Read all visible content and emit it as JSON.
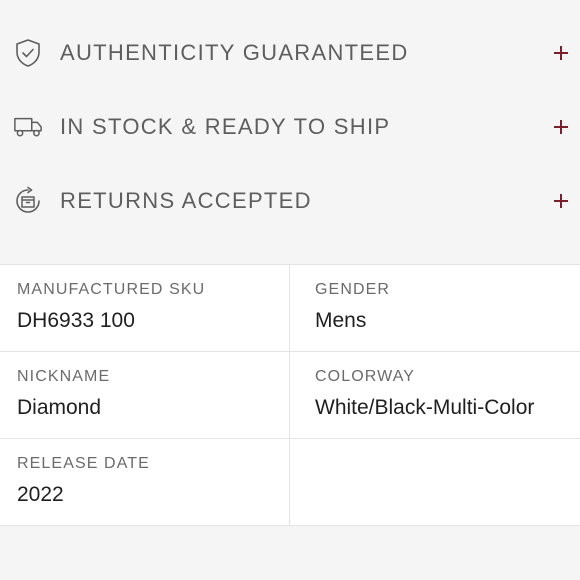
{
  "accordion": {
    "items": [
      {
        "label": "AUTHENTICITY GUARANTEED",
        "icon": "shield-check-icon"
      },
      {
        "label": "IN STOCK & READY TO SHIP",
        "icon": "truck-icon"
      },
      {
        "label": "RETURNS ACCEPTED",
        "icon": "return-box-icon"
      }
    ],
    "plus_color": "#7a1f2b"
  },
  "details": {
    "manufactured_sku": {
      "label": "MANUFACTURED SKU",
      "value": "DH6933 100"
    },
    "gender": {
      "label": "GENDER",
      "value": "Mens"
    },
    "nickname": {
      "label": "NICKNAME",
      "value": "Diamond"
    },
    "colorway": {
      "label": "COLORWAY",
      "value": "White/Black-Multi-Color"
    },
    "release_date": {
      "label": "RELEASE DATE",
      "value": "2022"
    }
  }
}
